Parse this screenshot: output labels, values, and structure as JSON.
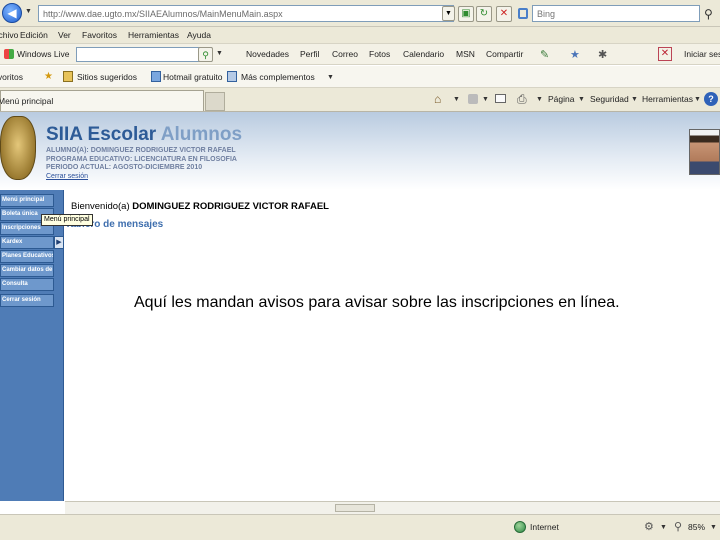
{
  "browser": {
    "address": "http://www.dae.ugto.mx/SIIAEAlumnos/MainMenuMain.aspx",
    "search_placeholder": "Bing",
    "menu": [
      "Archivo",
      "Edición",
      "Ver",
      "Favoritos",
      "Herramientas",
      "Ayuda"
    ],
    "live_toolbar": {
      "brand": "Windows Live",
      "links": [
        "Novedades",
        "Perfil",
        "Correo",
        "Fotos",
        "Calendario",
        "MSN",
        "Compartir"
      ],
      "signin": "Iniciar sesión"
    },
    "favorites_bar": {
      "label": "Favoritos",
      "items": [
        "Sitios sugeridos",
        "Hotmail gratuito",
        "Más complementos"
      ]
    },
    "tab": {
      "title": "Menú principal"
    },
    "command_bar": [
      "Página",
      "Seguridad",
      "Herramientas"
    ],
    "status": {
      "zone": "Internet",
      "zoom": "85%"
    }
  },
  "app": {
    "title_main": "SIIA Escolar",
    "title_sub": "Alumnos",
    "student_label": "ALUMNO(A):",
    "student_name": "DOMINGUEZ RODRIGUEZ VICTOR RAFAEL",
    "program_label": "PROGRAMA EDUCATIVO:",
    "program_value": "LICENCIATURA EN FILOSOFIA",
    "period_label": "PERIODO ACTUAL:",
    "period_value": "AGOSTO-DICIEMBRE 2010",
    "logout": "Cerrar sesión",
    "welcome_prefix": "Bienvenido(a)",
    "welcome_name": "DOMINGUEZ RODRIGUEZ VICTOR RAFAEL",
    "messages_title": "Tablero de mensajes",
    "tooltip": "Menú principal"
  },
  "sidebar": {
    "items": [
      "Menú principal",
      "Boleta única",
      "Inscripciones",
      "Kardex",
      "Planes Educativos",
      "Cambiar datos de interés",
      "Consulta",
      "Cerrar sesión"
    ]
  },
  "annotation": {
    "text": "Aquí les mandan avisos para avisar sobre las inscripciones en línea."
  }
}
